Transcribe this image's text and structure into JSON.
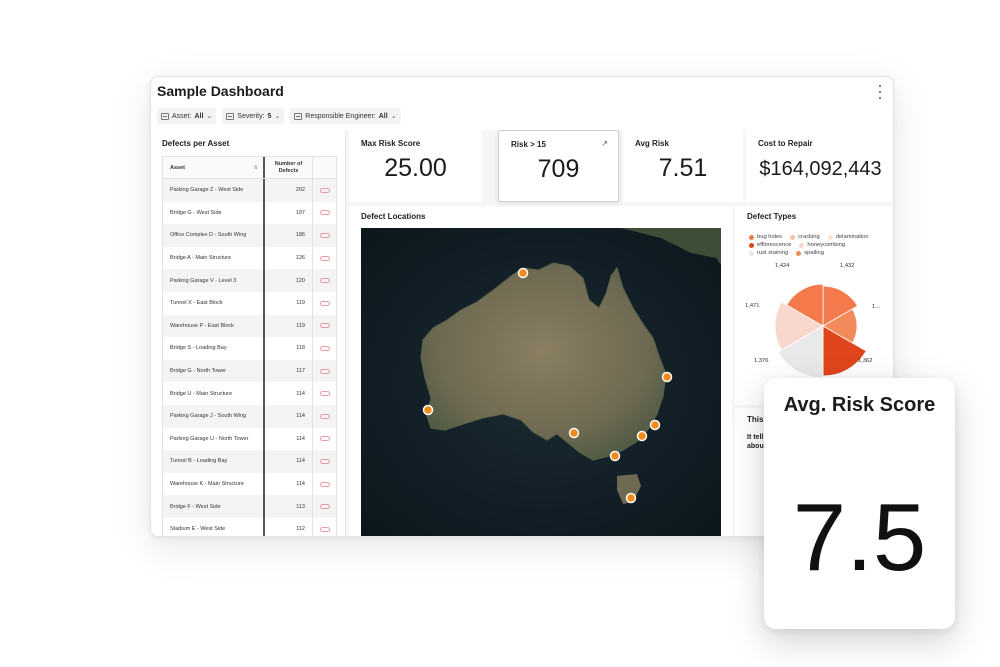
{
  "dashboard": {
    "title": "Sample Dashboard"
  },
  "filters": [
    {
      "label": "Asset:",
      "value": "All"
    },
    {
      "label": "Severity:",
      "value": "5"
    },
    {
      "label": "Responsible Engineer:",
      "value": "All"
    }
  ],
  "defects_per_asset": {
    "title": "Defects per Asset",
    "columns": [
      "Asset",
      "Number of Defects"
    ],
    "rows": [
      {
        "asset": "Parking Garage Z - West Side",
        "count": "202"
      },
      {
        "asset": "Bridge G - West Side",
        "count": "197"
      },
      {
        "asset": "Office Complex D - South Wing",
        "count": "186"
      },
      {
        "asset": "Bridge A - Main Structure",
        "count": "126"
      },
      {
        "asset": "Parking Garage V - Level 3",
        "count": "120"
      },
      {
        "asset": "Tunnel X - East Block",
        "count": "119"
      },
      {
        "asset": "Warehouse P - East Block",
        "count": "119"
      },
      {
        "asset": "Bridge S - Loading Bay",
        "count": "118"
      },
      {
        "asset": "Bridge G - North Tower",
        "count": "117"
      },
      {
        "asset": "Bridge U - Main Structure",
        "count": "114"
      },
      {
        "asset": "Parking Garage J - South Wing",
        "count": "114"
      },
      {
        "asset": "Parking Garage U - North Tower",
        "count": "114"
      },
      {
        "asset": "Tunnel B - Loading Bay",
        "count": "114"
      },
      {
        "asset": "Warehouse K - Main Structure",
        "count": "114"
      },
      {
        "asset": "Bridge F - West Side",
        "count": "113"
      },
      {
        "asset": "Stadium E - West Side",
        "count": "112"
      }
    ]
  },
  "kpis": [
    {
      "label": "Max Risk Score",
      "value": "25.00"
    },
    {
      "label": "Risk > 15",
      "value": "709"
    },
    {
      "label": "Avg Risk",
      "value": "7.51"
    },
    {
      "label": "Cost to Repair",
      "value": "$164,092,443"
    }
  ],
  "map": {
    "title": "Defect Locations",
    "marker_color": "#f08a1c"
  },
  "defect_types": {
    "title": "Defect Types",
    "legend": [
      {
        "name": "bug holes",
        "color": "#f47a4c"
      },
      {
        "name": "cracking",
        "color": "#f9c1a8"
      },
      {
        "name": "delamination",
        "color": "#fde3d6"
      },
      {
        "name": "efflorescence",
        "color": "#e0461b"
      },
      {
        "name": "honeycombing",
        "color": "#f8d7cc"
      },
      {
        "name": "rust staining",
        "color": "#e9e9e9"
      },
      {
        "name": "spalling",
        "color": "#f38a5a"
      }
    ],
    "labels": [
      "1,424",
      "1,432",
      "1...",
      "1,362",
      "1,376",
      "1,471"
    ]
  },
  "text_panel": {
    "title": "This",
    "body_line1": "It tell",
    "body_line2": "abou"
  },
  "highlight_card": {
    "title": "Avg. Risk Score",
    "value": "7.5"
  }
}
